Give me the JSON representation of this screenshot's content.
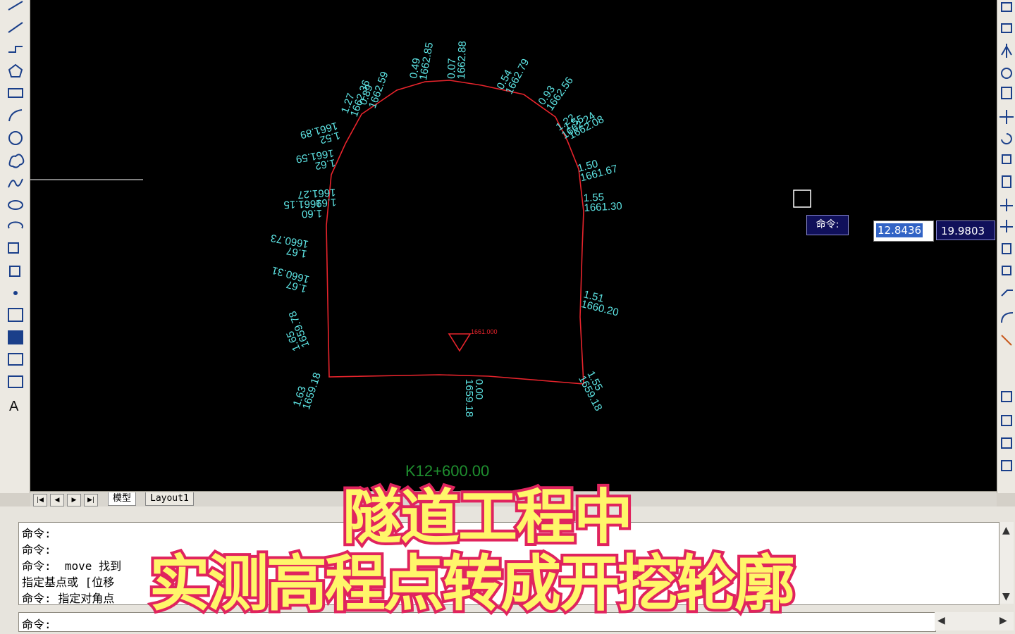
{
  "tabs": [
    {
      "label": "模型",
      "active": true
    },
    {
      "label": "Layout1",
      "active": false
    }
  ],
  "nav_buttons": [
    "|◀",
    "◀",
    "▶",
    "▶|"
  ],
  "command": {
    "history": [
      "命令:",
      "命令:",
      "命令:  move 找到",
      "指定基点或 [位移",
      "命令: 指定对角点"
    ],
    "input_label": "命令:"
  },
  "dynamic_input": {
    "prompt": "命令:",
    "x_value": "12.8436",
    "y_value": "19.9803"
  },
  "overlay": {
    "line1": "隧道工程中",
    "line2": "实测高程点转成开挖轮廓"
  },
  "drawing": {
    "station_label": "K12+600.00",
    "center_elevation": "1661.000",
    "colors": {
      "canvas": "#000000",
      "profile": "#e8242c",
      "labels": "#5ee6e6",
      "station": "#1f8f2f",
      "crosshair": "#ffffff"
    },
    "labels": [
      {
        "offset": "1.27",
        "elev": "1662.36"
      },
      {
        "offset": "0.89",
        "elev": "1662.59"
      },
      {
        "offset": "0.49",
        "elev": "1662.85"
      },
      {
        "offset": "0.07",
        "elev": "1662.88"
      },
      {
        "offset": "0.54",
        "elev": "1662.79"
      },
      {
        "offset": "0.93",
        "elev": "1662.56"
      },
      {
        "offset": "1.22",
        "elev": "1662.24"
      },
      {
        "offset": "1.50",
        "elev": "1661.67"
      },
      {
        "offset": "1.55",
        "elev": "1661.30"
      },
      {
        "offset": "1.51",
        "elev": "1660.20"
      },
      {
        "offset": "1.52",
        "elev": "1661.89"
      },
      {
        "offset": "1.62",
        "elev": "1661.59"
      },
      {
        "offset": "1.69",
        "elev": "1661.27"
      },
      {
        "offset": "1.67",
        "elev": "1660.73"
      },
      {
        "offset": "1.67",
        "elev": "1660.31"
      },
      {
        "offset": "1.65",
        "elev": "1659.78"
      },
      {
        "offset": "0.00",
        "elev": "1659.18"
      },
      {
        "offset": "1.55",
        "elev": "1662.08"
      },
      {
        "offset": "1.60",
        "elev": "1661.15"
      },
      {
        "offset": "1.63",
        "elev": "1659.18"
      },
      {
        "offset": "1.55",
        "elev": "1659.18"
      }
    ]
  },
  "icons": {
    "left": [
      "line-icon",
      "polyline-icon",
      "xline-icon",
      "polygon-icon",
      "rectangle-icon",
      "arc-icon",
      "circle-icon",
      "revcloud-icon",
      "spline-icon",
      "ellipse-icon",
      "ellipse-arc-icon",
      "insert-block-icon",
      "make-block-icon",
      "point-icon",
      "hatch-icon",
      "gradient-icon",
      "region-icon",
      "table-icon",
      "mtext-icon"
    ],
    "right": [
      "erase-icon",
      "copy-icon",
      "mirror-icon",
      "offset-icon",
      "array-icon",
      "move-icon",
      "rotate-icon",
      "scale-icon",
      "stretch-icon",
      "trim-icon",
      "extend-icon",
      "break-icon",
      "join-icon",
      "chamfer-icon",
      "fillet-icon",
      "explode-icon",
      "draworder-icon",
      "layer-icon",
      "properties-icon",
      "match-icon"
    ]
  }
}
